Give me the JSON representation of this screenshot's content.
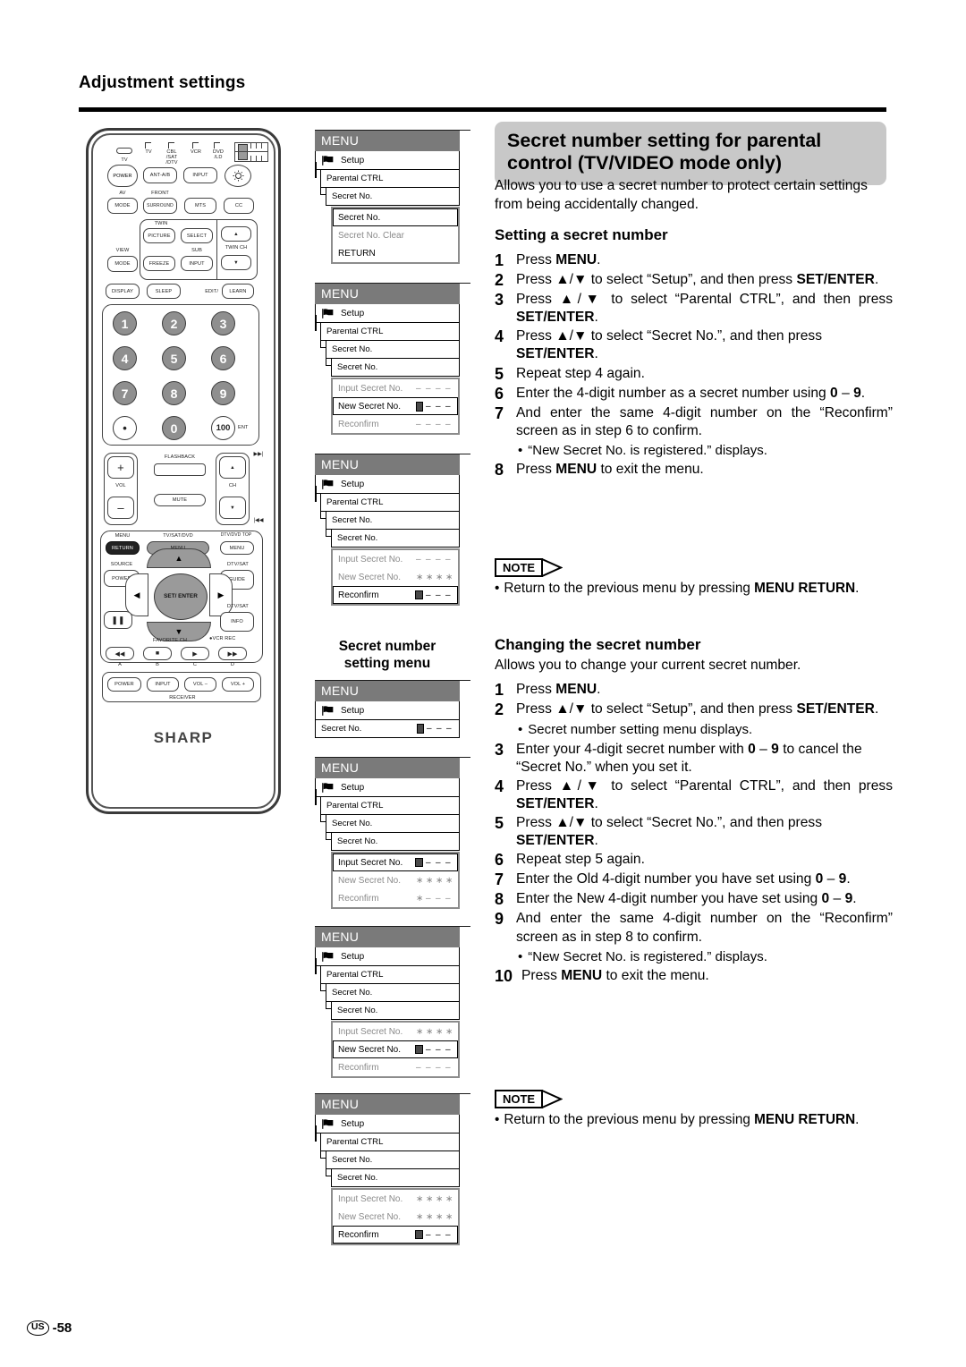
{
  "page": {
    "title": "Adjustment settings",
    "footer_region": "US",
    "footer_page": "-58"
  },
  "section": {
    "heading": "Secret number setting for parental control (TV/VIDEO mode only)",
    "intro": "Allows you to use a secret number to protect certain settings from being accidentally changed."
  },
  "setting": {
    "heading": "Setting a secret number",
    "steps": [
      {
        "n": "1",
        "text": "Press MENU."
      },
      {
        "n": "2",
        "text": "Press ▲/▼ to select “Setup”, and then press SET/ENTER."
      },
      {
        "n": "3",
        "text": "Press ▲/▼ to select “Parental CTRL”, and then press SET/ENTER."
      },
      {
        "n": "4",
        "text": "Press ▲/▼ to select “Secret No.”, and then press SET/ENTER."
      },
      {
        "n": "5",
        "text": "Repeat step 4 again."
      },
      {
        "n": "6",
        "text": "Enter the 4-digit number as a secret number using 0 – 9."
      },
      {
        "n": "7",
        "text": "And enter the same 4-digit number on the “Reconfirm” screen as in step 6 to confirm."
      },
      {
        "n": "8",
        "text": "Press MENU to exit the menu."
      }
    ],
    "bullet_after_7": "“New Secret No. is registered.” displays."
  },
  "changing": {
    "heading": "Changing the secret number",
    "intro": "Allows you to change your current secret number.",
    "steps": [
      {
        "n": "1",
        "text": "Press MENU."
      },
      {
        "n": "2",
        "text": "Press ▲/▼ to select “Setup”, and then press SET/ENTER."
      },
      {
        "n": "3",
        "text": "Enter your 4-digit secret number with 0 – 9 to cancel the “Secret No.” when you set it."
      },
      {
        "n": "4",
        "text": "Press ▲/▼ to select “Parental CTRL”, and then press SET/ENTER."
      },
      {
        "n": "5",
        "text": "Press ▲/▼ to select “Secret No.”, and then press SET/ENTER."
      },
      {
        "n": "6",
        "text": "Repeat step 5 again."
      },
      {
        "n": "7",
        "text": "Enter the Old 4-digit number you have set using 0 – 9."
      },
      {
        "n": "8",
        "text": "Enter the New 4-digit number you have set using 0 – 9."
      },
      {
        "n": "9",
        "text": "And enter the same 4-digit number on the “Reconfirm” screen as in step 8 to confirm."
      },
      {
        "n": "10",
        "text": "Press MENU to exit the menu."
      }
    ],
    "bullet_after_2": "Secret number setting menu displays.",
    "bullet_after_9": "“New Secret No. is registered.” displays."
  },
  "note": {
    "tag": "NOTE",
    "text": "Return to the previous menu by pressing MENU RETURN."
  },
  "osd_caption": "Secret number setting menu",
  "osd": {
    "menu_bar": "MENU",
    "setup": "Setup",
    "parental": "Parental CTRL",
    "secret_no": "Secret No.",
    "secret_no_clear": "Secret No. Clear",
    "return": "RETURN",
    "input_secret": "Input Secret No.",
    "new_secret": "New Secret No.",
    "reconfirm": "Reconfirm",
    "dash": "–",
    "star": "∗"
  },
  "remote": {
    "brand": "SHARP",
    "top_labels": [
      "TV",
      "CBL /SAT /DTV",
      "VCR",
      "DVD /LD"
    ],
    "tv_label": "TV",
    "power": "POWER",
    "ant_ab": "ANT-A/B",
    "input": "INPUT",
    "av": "AV",
    "mode": "MODE",
    "front": "FRONT",
    "surround": "SURROUND",
    "mts": "MTS",
    "cc": "CC",
    "twin": "TWIN",
    "picture": "PICTURE",
    "select": "SELECT",
    "view": "VIEW",
    "freeze": "FREEZE",
    "sub": "SUB",
    "twin_ch": "TWIN CH",
    "display": "DISPLAY",
    "sleep": "SLEEP",
    "edit": "EDIT/",
    "learn": "LEARN",
    "keys": [
      "1",
      "2",
      "3",
      "4",
      "5",
      "6",
      "7",
      "8",
      "9",
      "•",
      "0",
      "100"
    ],
    "ent": "ENT",
    "vol": "VOL",
    "plus": "+",
    "minus": "–",
    "flashback": "FLASHBACK",
    "mute": "MUTE",
    "ch": "CH",
    "menu_label": "MENU",
    "return": "RETURN",
    "tv_sat_dvd": "TV/SAT/DVD",
    "menu_btn": "MENU",
    "dtv_dvd_top": "DTV/DVD TOP",
    "menu_btn2": "MENU",
    "source": "SOURCE",
    "source_power": "POWER",
    "dtv_sat": "DTV/SAT",
    "guide": "GUIDE",
    "set_enter": "SET/ ENTER",
    "info": "INFO",
    "favorite_ch": "FAVORITE CH",
    "vcr_rec": "VCR REC",
    "abcd": [
      "A",
      "B",
      "C",
      "D"
    ],
    "rcv_power": "POWER",
    "rcv_input": "INPUT",
    "vol_minus": "VOL –",
    "vol_plus": "VOL +",
    "receiver": "RECEIVER"
  },
  "colors": {
    "menu_bar_bg": "#7a7a7a",
    "section_head_bg": "#c8c8c8",
    "dim_text": "#8a8a8a",
    "key_grey": "#8f8f8f"
  }
}
